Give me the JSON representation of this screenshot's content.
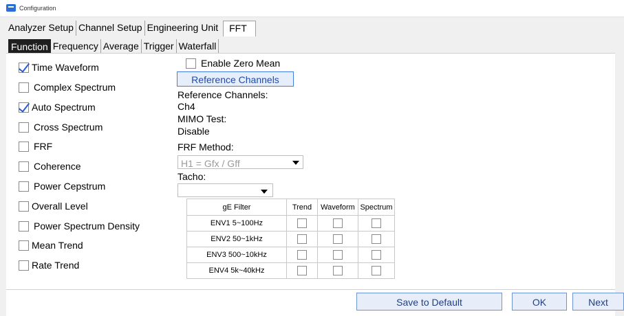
{
  "window": {
    "title": "Configuration"
  },
  "tabs_main": [
    "Analyzer Setup",
    "Channel Setup",
    "Engineering Unit",
    "FFT"
  ],
  "tabs_fft": [
    "Function",
    "Frequency",
    "Average",
    "Trigger",
    "Waterfall"
  ],
  "functions": [
    {
      "label": "Time Waveform",
      "checked": true
    },
    {
      "label": "Complex Spectrum",
      "checked": false
    },
    {
      "label": "Auto Spectrum",
      "checked": true
    },
    {
      "label": "Cross Spectrum",
      "checked": false
    },
    {
      "label": "FRF",
      "checked": false
    },
    {
      "label": "Coherence",
      "checked": false
    },
    {
      "label": "Power Cepstrum",
      "checked": false
    },
    {
      "label": "Overall Level",
      "checked": false
    },
    {
      "label": "Power Spectrum Density",
      "checked": false
    },
    {
      "label": "Mean Trend",
      "checked": false
    },
    {
      "label": "Rate Trend",
      "checked": false
    }
  ],
  "settings": {
    "enable_zero_mean": "Enable Zero Mean",
    "reference_channels_button": "Reference Channels",
    "reference_channels_label": "Reference Channels:",
    "reference_channels_value": "Ch4",
    "mimo_label": "MIMO Test:",
    "mimo_value": "Disable",
    "frf_method_label": "FRF Method:",
    "frf_method_value": "H1 = Gfx / Gff",
    "tacho_label": "Tacho:",
    "tacho_value": ""
  },
  "ge_table": {
    "headers": [
      "gE Filter",
      "Trend",
      "Waveform",
      "Spectrum"
    ],
    "rows": [
      "ENV1 5~100Hz",
      "ENV2 50~1kHz",
      "ENV3 500~10kHz",
      "ENV4 5k~40kHz"
    ]
  },
  "buttons": {
    "save_default": "Save to Default",
    "ok": "OK",
    "next": "Next"
  }
}
